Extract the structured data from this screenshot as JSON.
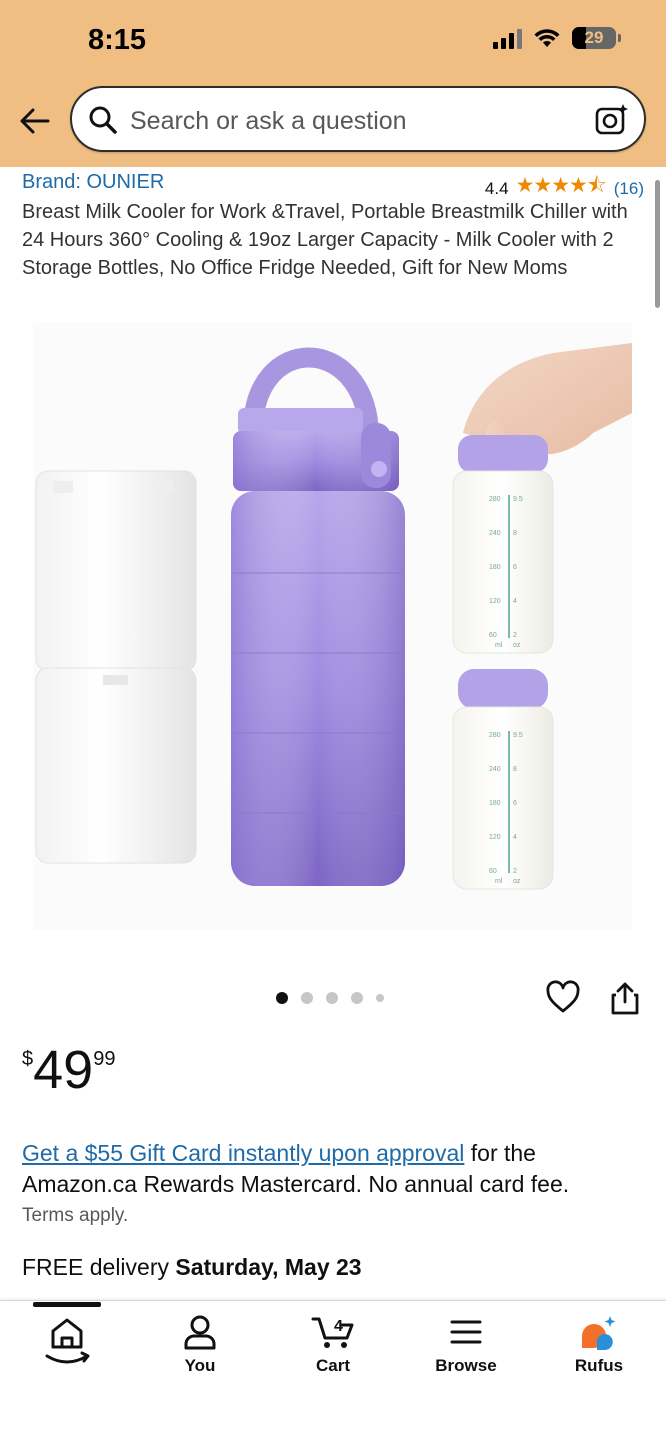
{
  "status": {
    "time": "8:15",
    "battery": "29"
  },
  "search": {
    "placeholder": "Search or ask a question"
  },
  "product": {
    "brand": "Brand: OUNIER",
    "rating": "4.4",
    "rating_stars": 4.4,
    "stars_glyph": "★★★★⯪",
    "rating_count": "(16)",
    "title": "Breast Milk Cooler for Work &Travel, Portable Breastmilk Chiller with 24 Hours 360° Cooling & 19oz Larger Capacity - Milk Cooler with 2 Storage Bottles, No Office Fridge Needed, Gift for New Moms",
    "image_count": 5,
    "current_image": 1,
    "image_labels": {
      "ml": "ml",
      "oz": "oz",
      "ticks": [
        "280",
        "240",
        "180",
        "120",
        "60"
      ],
      "oz_ticks": [
        "9.5",
        "8",
        "6",
        "4",
        "2"
      ]
    }
  },
  "price": {
    "currency": "$",
    "whole": "49",
    "fraction": "99"
  },
  "promo": {
    "link_text": "Get a $55 Gift Card instantly upon approval",
    "rest_text": " for the Amazon.ca Rewards Mastercard. No annual card fee.",
    "terms": "Terms apply."
  },
  "delivery": {
    "prefix": "FREE delivery ",
    "date": "Saturday, May 23"
  },
  "nav": {
    "home": "",
    "you": "You",
    "cart": "Cart",
    "cart_count": "4",
    "browse": "Browse",
    "rufus": "Rufus"
  },
  "colors": {
    "header_bg": "#f0be82",
    "link": "#1f6aa8",
    "star": "#f08804",
    "product_purple": "#9b86d6"
  },
  "icons": [
    "back-arrow-icon",
    "search-icon",
    "camera-icon",
    "heart-icon",
    "share-icon",
    "home-icon",
    "user-icon",
    "cart-icon",
    "menu-icon",
    "rufus-icon"
  ]
}
